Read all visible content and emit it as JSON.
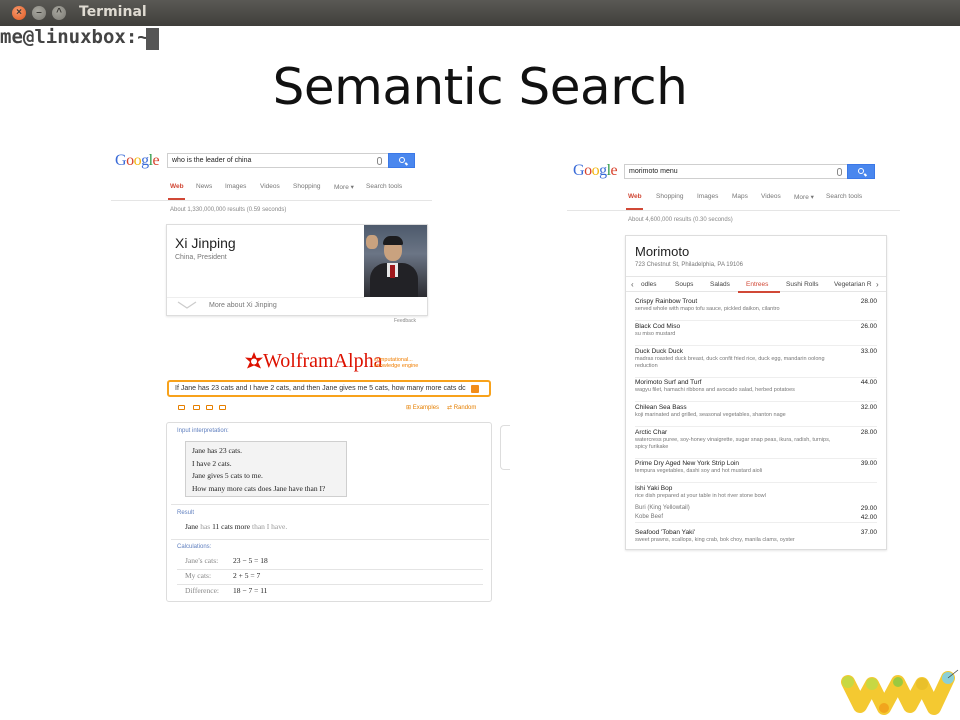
{
  "window": {
    "title": "Terminal",
    "prompt": "me@linuxbox:~"
  },
  "slide": {
    "title": "Semantic Search"
  },
  "google1": {
    "logo": [
      "G",
      "o",
      "o",
      "g",
      "l",
      "e"
    ],
    "query": "who is the leader of china",
    "tabs": [
      "Web",
      "News",
      "Images",
      "Videos",
      "Shopping",
      "More ▾",
      "Search tools"
    ],
    "stats": "About 1,330,000,000 results (0.59 seconds)",
    "card": {
      "name": "Xi Jinping",
      "desc": "China, President",
      "more": "More about Xi Jinping"
    },
    "feedback": "Feedback"
  },
  "wolfram": {
    "brand": "WolframAlpha",
    "tagline": [
      "computational...",
      "knowledge engine"
    ],
    "input": "If Jane has 23 cats and I have 2 cats, and then Jane gives me 5 cats, how many more cats dc",
    "examples": "Examples",
    "random": "Random",
    "interp_label": "Input interpretation:",
    "interp": [
      "Jane has 23 cats.",
      "I have 2 cats.",
      "Jane gives 5 cats to me.",
      "How many more cats does Jane have than I?"
    ],
    "result_label": "Result",
    "result": {
      "a": "Jane",
      "b": "has",
      "c": "11 cats more",
      "d": "than I have."
    },
    "calc_label": "Calculations:",
    "calcs": [
      {
        "label": "Jane's cats:",
        "expr": "23 − 5 = 18"
      },
      {
        "label": "My cats:",
        "expr": "2 + 5 = 7"
      },
      {
        "label": "Difference:",
        "expr": "18 − 7 = 11"
      }
    ]
  },
  "google2": {
    "logo": [
      "G",
      "o",
      "o",
      "g",
      "l",
      "e"
    ],
    "query": "morimoto menu",
    "tabs": [
      "Web",
      "Shopping",
      "Images",
      "Maps",
      "Videos",
      "More ▾",
      "Search tools"
    ],
    "stats": "About 4,600,000 results (0.30 seconds)",
    "card": {
      "name": "Morimoto",
      "address": "723 Chestnut St, Philadelphia, PA 19106",
      "tabs": [
        "odles",
        "Soups",
        "Salads",
        "Entrees",
        "Sushi Rolls",
        "Vegetarian R"
      ],
      "active_tab": "Entrees",
      "items": [
        {
          "name": "Crispy Rainbow Trout",
          "desc": "served whole with mapo tofu sauce, pickled daikon, cilantro",
          "price": "28.00"
        },
        {
          "name": "Black Cod Miso",
          "desc": "su miso mustard",
          "price": "26.00"
        },
        {
          "name": "Duck Duck Duck",
          "desc": "madras roasted duck breast, duck confit fried rice, duck egg, mandarin oolong reduction",
          "price": "33.00"
        },
        {
          "name": "Morimoto Surf and Turf",
          "desc": "wagyu filet, hamachi ribbons and avocado salad, herbed potatoes",
          "price": "44.00"
        },
        {
          "name": "Chilean Sea Bass",
          "desc": "koji marinated and grilled, seasonal vegetables, shanton nage",
          "price": "32.00"
        },
        {
          "name": "Arctic Char",
          "desc": "watercress puree, soy-honey vinaigrette, sugar snap peas, ikura, radish, turnips, spicy furikake",
          "price": "28.00"
        },
        {
          "name": "Prime Dry Aged New York Strip Loin",
          "desc": "tempura vegetables, dashi soy and hot mustard aioli",
          "price": "39.00"
        },
        {
          "name": "Ishi Yaki Bop",
          "desc": "rice dish prepared at your table in hot river stone bowl",
          "price": ""
        },
        {
          "name": "Seafood 'Toban Yaki'",
          "desc": "sweet prawns, scallops, king crab, bok choy, manila clams, oyster",
          "price": "37.00"
        }
      ],
      "subitems": [
        {
          "name": "Buri (King Yellowtail)",
          "price": "29.00"
        },
        {
          "name": "Kobe Beef",
          "price": "42.00"
        }
      ]
    }
  },
  "colors": {
    "google_red": "#d14836",
    "wolfram_orange": "#f8a21b",
    "search_blue": "#4a87ee"
  }
}
